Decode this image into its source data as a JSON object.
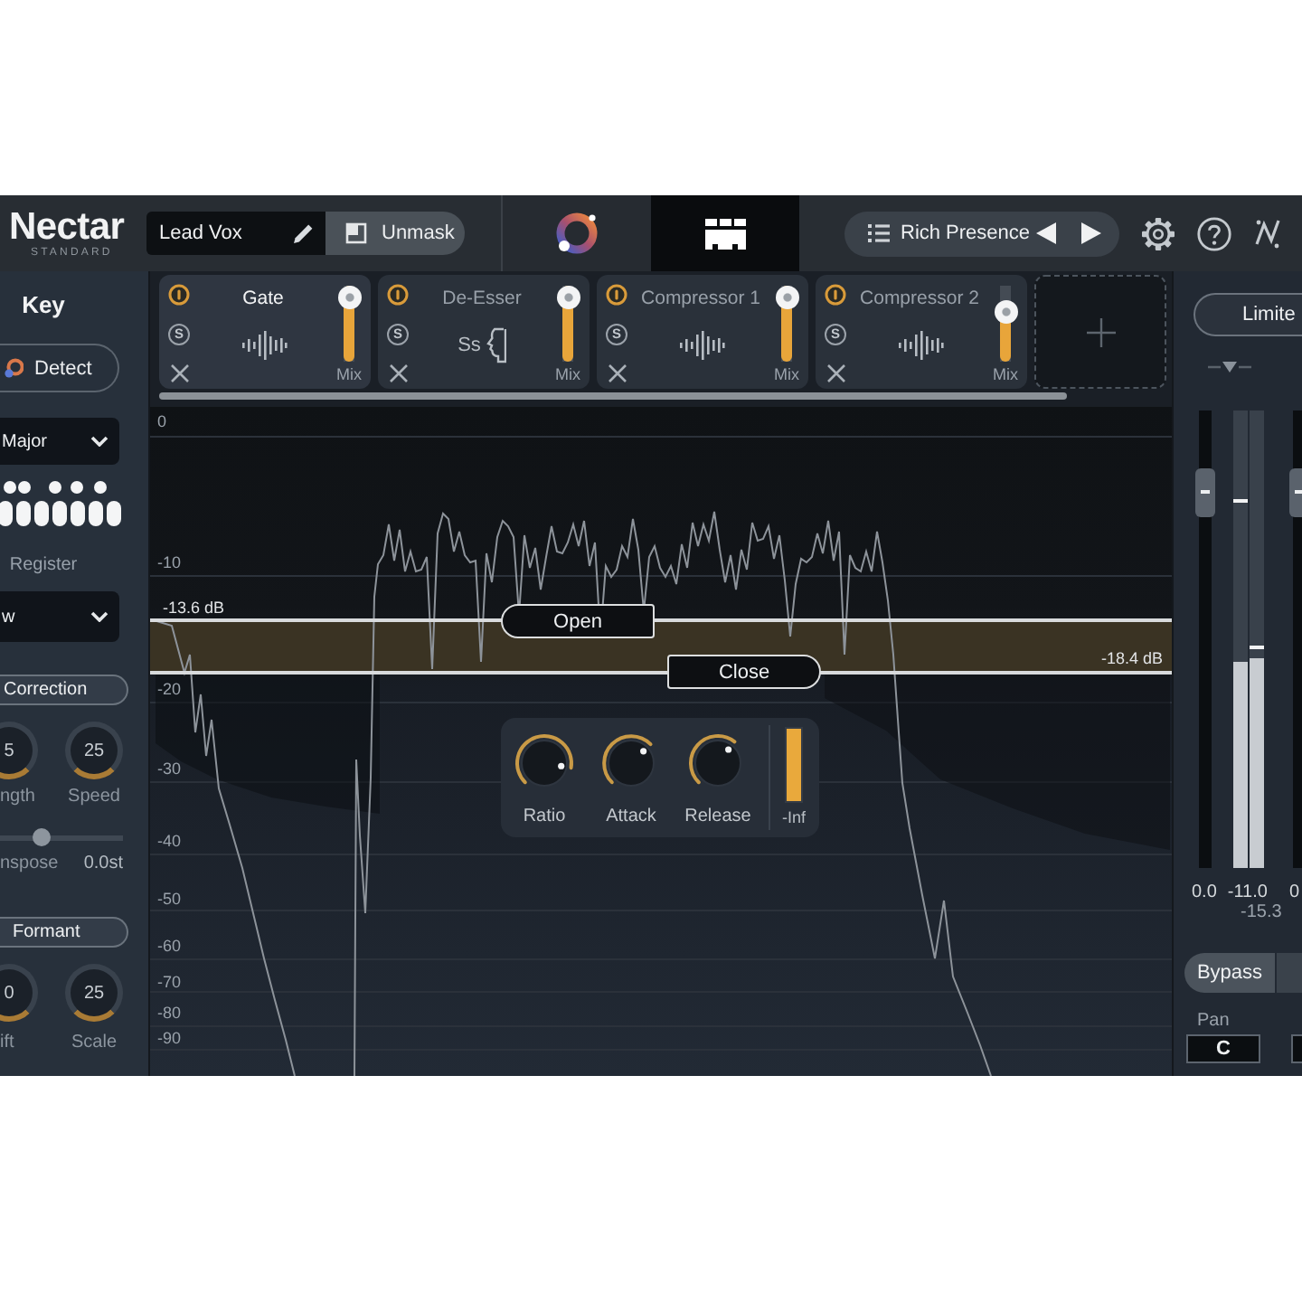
{
  "header": {
    "logo": "Nectar",
    "logo_subtitle": "STANDARD",
    "preset_name": "Lead Vox",
    "unmask_button": "Unmask",
    "view_tabs": [
      {
        "kind": "orb",
        "selected": false
      },
      {
        "kind": "modules",
        "selected": true
      }
    ],
    "preset_browser": "Rich Presence"
  },
  "left_panel": {
    "title": "Key",
    "detect_button": "Detect",
    "scale_dropdown": "Major",
    "register_label": "Register",
    "register_dropdown": "w",
    "correction_button": "Correction",
    "correction_knobs": [
      {
        "value": "5",
        "label": "ngth"
      },
      {
        "value": "25",
        "label": "Speed"
      }
    ],
    "transpose": {
      "label": "nspose",
      "value": "0.0st",
      "level": 0.5
    },
    "formant_button": "Formant",
    "formant_knobs": [
      {
        "value": "0",
        "label": "ift"
      },
      {
        "value": "25",
        "label": "Scale"
      }
    ]
  },
  "modules": [
    {
      "name": "Gate",
      "kind": "bars",
      "selected": true,
      "on": true,
      "solo_button": "S",
      "mix_label": "Mix",
      "level": 1
    },
    {
      "name": "De-Esser",
      "kind": "ess",
      "icon_text": "Ss",
      "selected": false,
      "on": true,
      "solo_button": "S",
      "mix_label": "Mix",
      "level": 1
    },
    {
      "name": "Compressor 1",
      "kind": "bars",
      "selected": false,
      "on": true,
      "solo_button": "S",
      "mix_label": "Mix",
      "level": 1
    },
    {
      "name": "Compressor 2",
      "kind": "bars",
      "selected": false,
      "on": true,
      "solo_button": "S",
      "mix_label": "Mix",
      "level": 0.72
    }
  ],
  "graph": {
    "scale_labels": [
      "0",
      "-10",
      "-20",
      "-30",
      "-40",
      "-50",
      "-60",
      "-70",
      "-80",
      "-90"
    ],
    "thresholds": [
      {
        "kind": "open",
        "label": "Open",
        "reading": "-13.6 dB"
      },
      {
        "kind": "close",
        "label": "Close",
        "reading": "-18.4 dB"
      }
    ],
    "knobs": [
      {
        "label": "Ratio",
        "level": 0.87
      },
      {
        "label": "Attack",
        "level": 0.67
      },
      {
        "label": "Release",
        "level": 0.64
      }
    ],
    "gain_meter": {
      "label": "-Inf",
      "level": 1
    }
  },
  "right_panel": {
    "limiter_button": "Limite",
    "strips": [
      {
        "fader": {
          "level": 0.86
        },
        "meters": [
          {
            "level": 0.45,
            "peak": {
              "level": 0.8
            }
          },
          {
            "level": 0.46,
            "peak": {
              "level": 0.48
            }
          }
        ],
        "readouts": [
          "0.0",
          "-11.0"
        ],
        "sub_readout": "-15.3",
        "pan_value": "C"
      },
      {
        "fader": {
          "level": 0.86
        },
        "readouts": [
          "0"
        ]
      }
    ],
    "bypass_button": "Bypass",
    "pan_label": "Pan"
  }
}
